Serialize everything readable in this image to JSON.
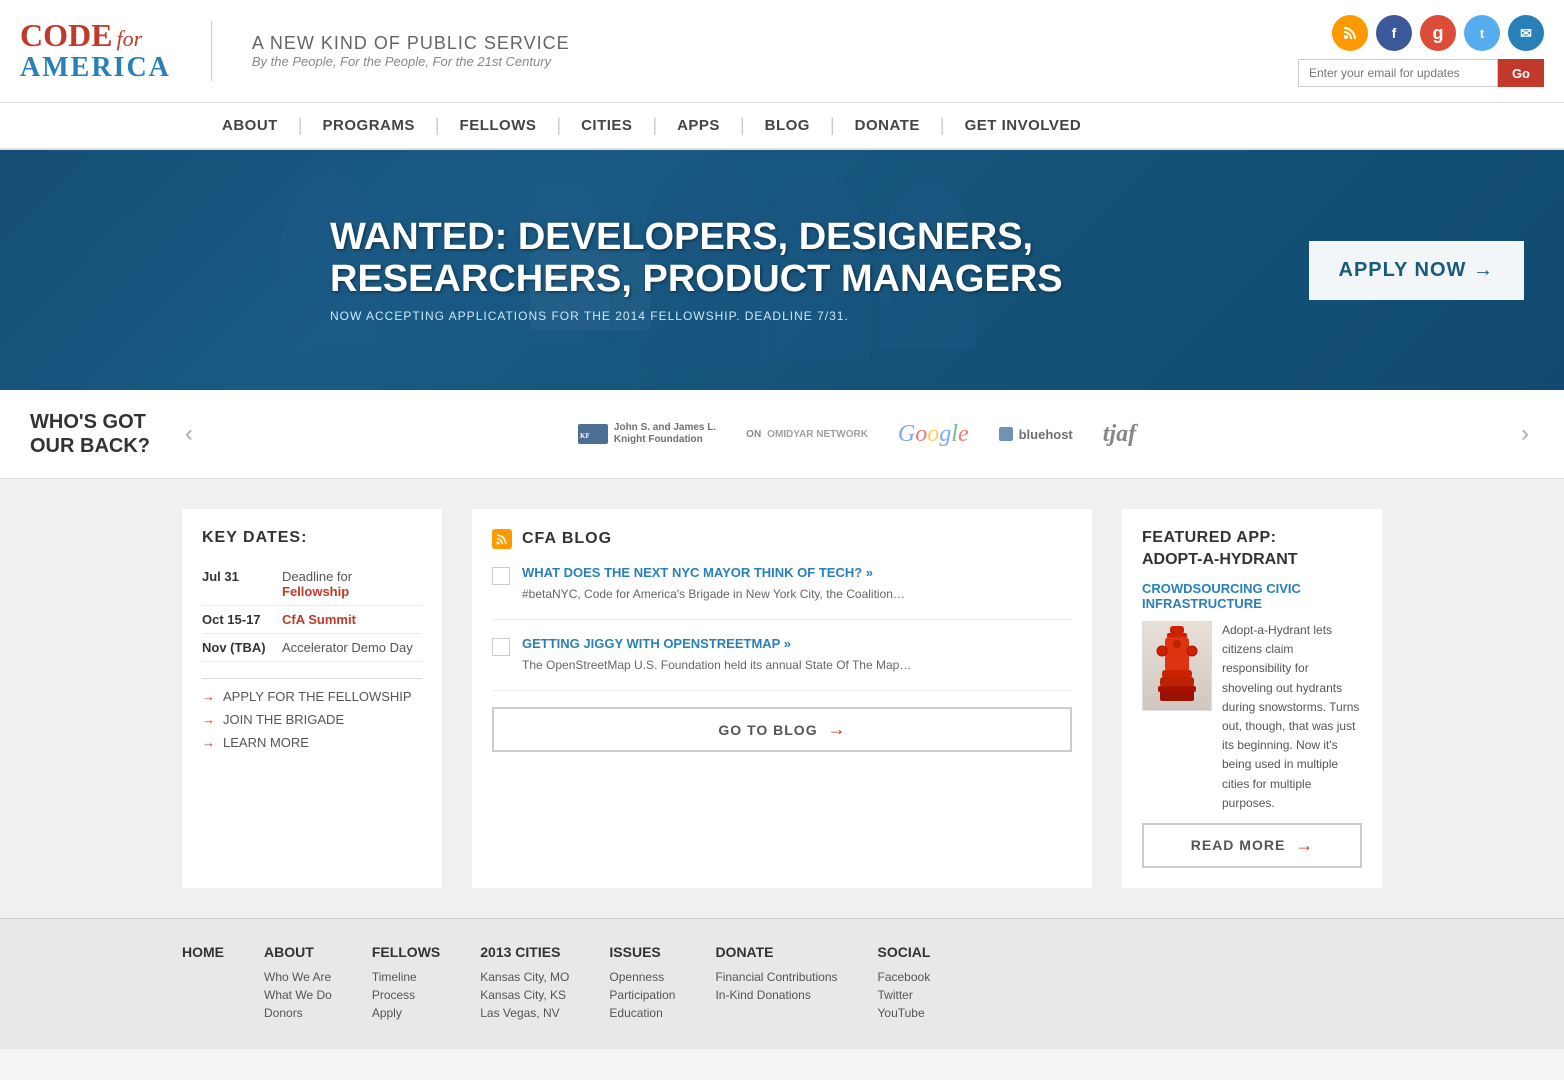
{
  "header": {
    "logo": {
      "code": "CODE",
      "for": "for",
      "america": "AMERICA"
    },
    "tagline": {
      "main": "A NEW KIND OF PUBLIC SERVICE",
      "sub": "By the People, For the People, For the 21st Century"
    },
    "social": {
      "icons": [
        "RSS",
        "f",
        "g",
        "t",
        "✉"
      ]
    },
    "email_placeholder": "Enter your email for updates",
    "go_button": "Go"
  },
  "nav": {
    "items": [
      "ABOUT",
      "PROGRAMS",
      "FELLOWS",
      "CITIES",
      "APPS",
      "BLOG",
      "DONATE",
      "GET INVOLVED"
    ]
  },
  "hero": {
    "title": "WANTED: DEVELOPERS, DESIGNERS,\nRESEARCHERS, PRODUCT MANAGERS",
    "subtitle": "NOW ACCEPTING APPLICATIONS FOR THE 2014 FELLOWSHIP. DEADLINE 7/31.",
    "cta_button": "APPLY NOW →"
  },
  "sponsors": {
    "label": "WHO'S GOT\nOUR BACK?",
    "logos": [
      "John S. and James L. Knight Foundation",
      "OMIDYAR NETWORK",
      "Google",
      "bluehost",
      "tjaf"
    ]
  },
  "key_dates": {
    "title": "KEY DATES:",
    "dates": [
      {
        "date": "Jul 31",
        "desc": "Deadline for ",
        "link": "Fellowship",
        "link_text": "Fellowship"
      },
      {
        "date": "Oct 15-17",
        "link": "CfA Summit",
        "link_text": "CfA Summit"
      },
      {
        "date": "Nov (TBA)",
        "desc": "Accelerator Demo Day"
      }
    ],
    "cta_links": [
      "APPLY FOR THE FELLOWSHIP",
      "JOIN THE BRIGADE",
      "LEARN MORE"
    ]
  },
  "blog": {
    "title": "CFA BLOG",
    "posts": [
      {
        "title": "WHAT DOES THE NEXT NYC MAYOR THINK OF TECH? »",
        "excerpt": "#betaNYC,  Code for America's Brigade in New York City, the Coalition…"
      },
      {
        "title": "GETTING JIGGY WITH OPENSTREETMAP »",
        "excerpt": "The OpenStreetMap U.S. Foundation held its annual State Of The Map…"
      }
    ],
    "go_button": "GO TO BLOG"
  },
  "featured_app": {
    "label": "FEATURED APP:",
    "name": "ADOPT-A-HYDRANT",
    "link": "CROWDSOURCING CIVIC INFRASTRUCTURE",
    "description": "Adopt-a-Hydrant lets citizens claim responsibility for shoveling out hydrants during snowstorms. Turns out, though, that was just its beginning. Now it's being used in multiple cities for multiple purposes.",
    "read_more": "READ MORE"
  },
  "footer": {
    "cols": [
      {
        "heading": "HOME",
        "links": []
      },
      {
        "heading": "ABOUT",
        "links": [
          "Who We Are",
          "What We Do",
          "Donors"
        ]
      },
      {
        "heading": "FELLOWS",
        "links": [
          "Timeline",
          "Process",
          "Apply"
        ]
      },
      {
        "heading": "2013 CITIES",
        "links": [
          "Kansas City, MO",
          "Kansas City, KS",
          "Las Vegas, NV"
        ]
      },
      {
        "heading": "ISSUES",
        "links": [
          "Openness",
          "Participation",
          "Education"
        ]
      },
      {
        "heading": "DONATE",
        "links": [
          "Financial Contributions",
          "In-Kind Donations"
        ]
      },
      {
        "heading": "SOCIAL",
        "links": [
          "Facebook",
          "Twitter",
          "YouTube"
        ]
      }
    ]
  }
}
